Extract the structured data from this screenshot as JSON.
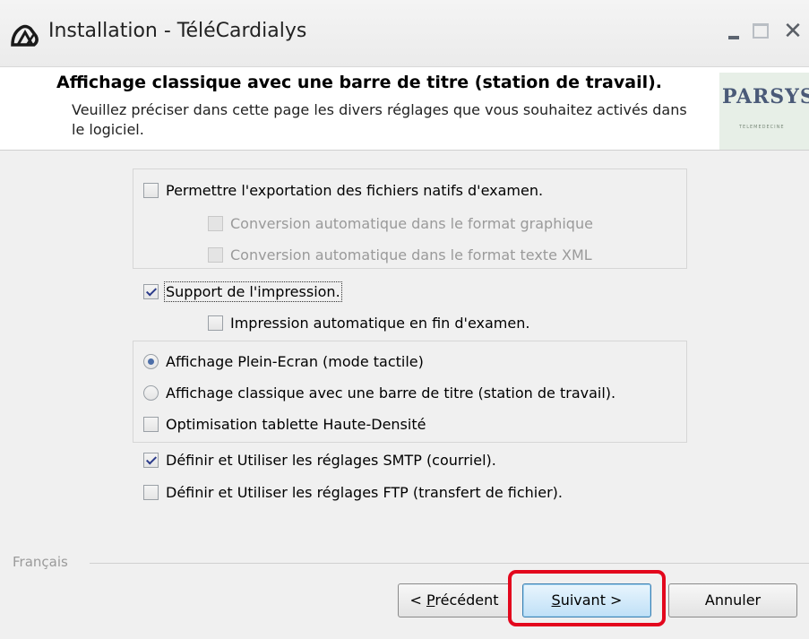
{
  "window": {
    "title": "Installation - TéléCardialys",
    "close_glyph": "✕"
  },
  "header": {
    "title": "Affichage classique avec une barre de titre (station de travail).",
    "description": "Veuillez préciser dans cette page les divers réglages que vous souhaitez activés dans le logiciel.",
    "logo_text": "PARSYS",
    "logo_subtext": "TELEMEDECINE"
  },
  "options": {
    "export_native": {
      "label": "Permettre l'exportation des fichiers natifs d'examen.",
      "checked": false
    },
    "convert_graphic": {
      "label": "Conversion automatique dans le format graphique",
      "checked": false,
      "enabled": false
    },
    "convert_xml": {
      "label": "Conversion automatique dans le format texte XML",
      "checked": false,
      "enabled": false
    },
    "print_support": {
      "label": "Support de l'impression.",
      "checked": true
    },
    "auto_print": {
      "label": "Impression automatique en fin d'examen.",
      "checked": false
    },
    "fullscreen": {
      "label": "Affichage Plein-Ecran (mode tactile)",
      "selected": true
    },
    "classic": {
      "label": "Affichage classique avec une barre de titre (station de travail).",
      "selected": false
    },
    "hd_tablet": {
      "label": "Optimisation tablette Haute-Densité",
      "checked": false
    },
    "smtp": {
      "label": "Définir et Utiliser les réglages SMTP (courriel).",
      "checked": true
    },
    "ftp": {
      "label": "Définir et Utiliser les réglages FTP (transfert de fichier).",
      "checked": false
    }
  },
  "footer": {
    "language": "Français",
    "prev_prefix": "< ",
    "prev_mnemonic": "P",
    "prev_rest": "récédent",
    "next_mnemonic": "S",
    "next_rest": "uivant >",
    "cancel": "Annuler"
  },
  "colors": {
    "highlight": "#e3071d",
    "next_button": "#bfe0f7"
  }
}
